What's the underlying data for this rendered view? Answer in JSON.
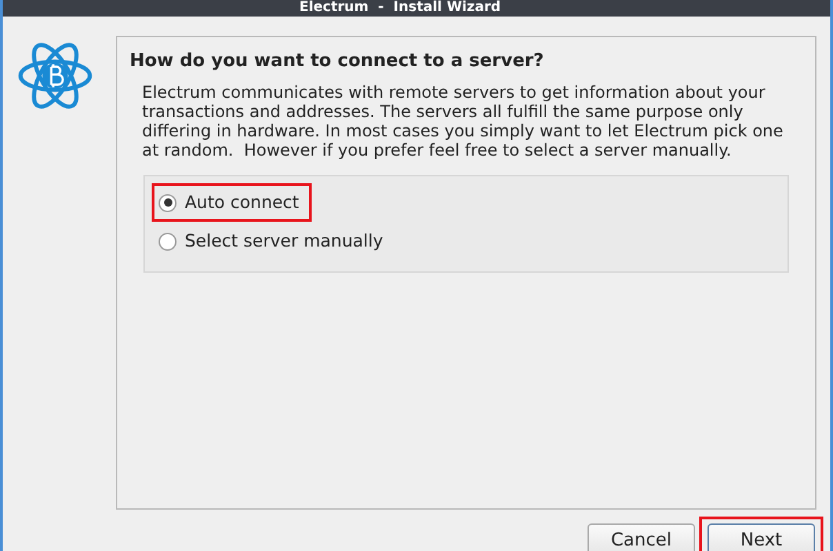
{
  "window": {
    "title": "Electrum  -  Install Wizard"
  },
  "heading": "How do you want to connect to a server?",
  "description": "Electrum communicates with remote servers to get information about your transactions and addresses. The servers all fulfill the same purpose only differing in hardware. In most cases you simply want to let Electrum pick one at random.  However if you prefer feel free to select a server manually.",
  "options": [
    {
      "label": "Auto connect",
      "selected": true,
      "highlighted": true
    },
    {
      "label": "Select server manually",
      "selected": false,
      "highlighted": false
    }
  ],
  "buttons": [
    {
      "label": "Cancel",
      "highlighted": false
    },
    {
      "label": "Next",
      "highlighted": true
    }
  ]
}
